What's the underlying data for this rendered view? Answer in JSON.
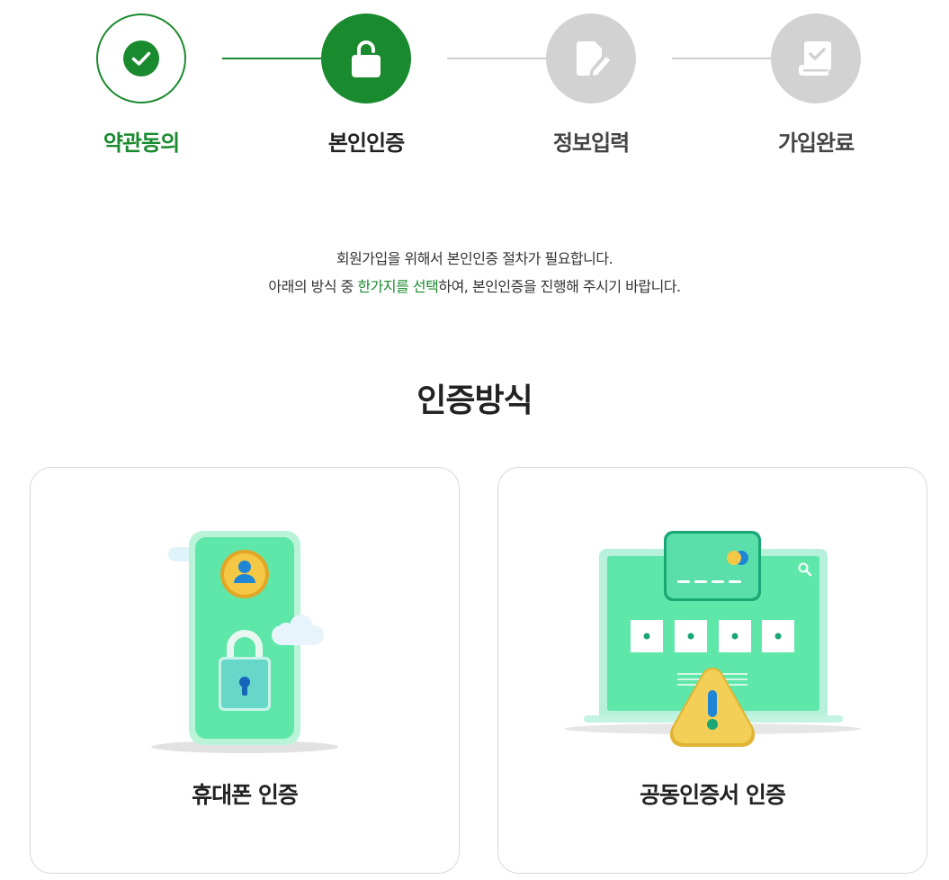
{
  "stepper": {
    "steps": [
      {
        "label": "약관동의",
        "status": "done",
        "icon": "check-icon"
      },
      {
        "label": "본인인증",
        "status": "current",
        "icon": "lock-open-icon"
      },
      {
        "label": "정보입력",
        "status": "todo",
        "icon": "edit-document-icon"
      },
      {
        "label": "가입완료",
        "status": "todo",
        "icon": "completed-book-icon"
      }
    ]
  },
  "intro": {
    "line1": "회원가입을 위해서 본인인증 절차가 필요합니다.",
    "line2_prefix": "아래의 방식 중 ",
    "line2_highlight": "한가지를 선택",
    "line2_suffix": "하여, 본인인증을 진행해 주시기 바랍니다."
  },
  "section": {
    "title": "인증방식"
  },
  "methods": [
    {
      "label": "휴대폰 인증",
      "icon": "phone-lock-illustration"
    },
    {
      "label": "공동인증서 인증",
      "icon": "certificate-laptop-illustration"
    }
  ],
  "colors": {
    "accent": "#1a8a2e",
    "inactive": "#d2d2d2",
    "illustration_green": "#5de3a8",
    "illustration_warning": "#f2c94c"
  }
}
